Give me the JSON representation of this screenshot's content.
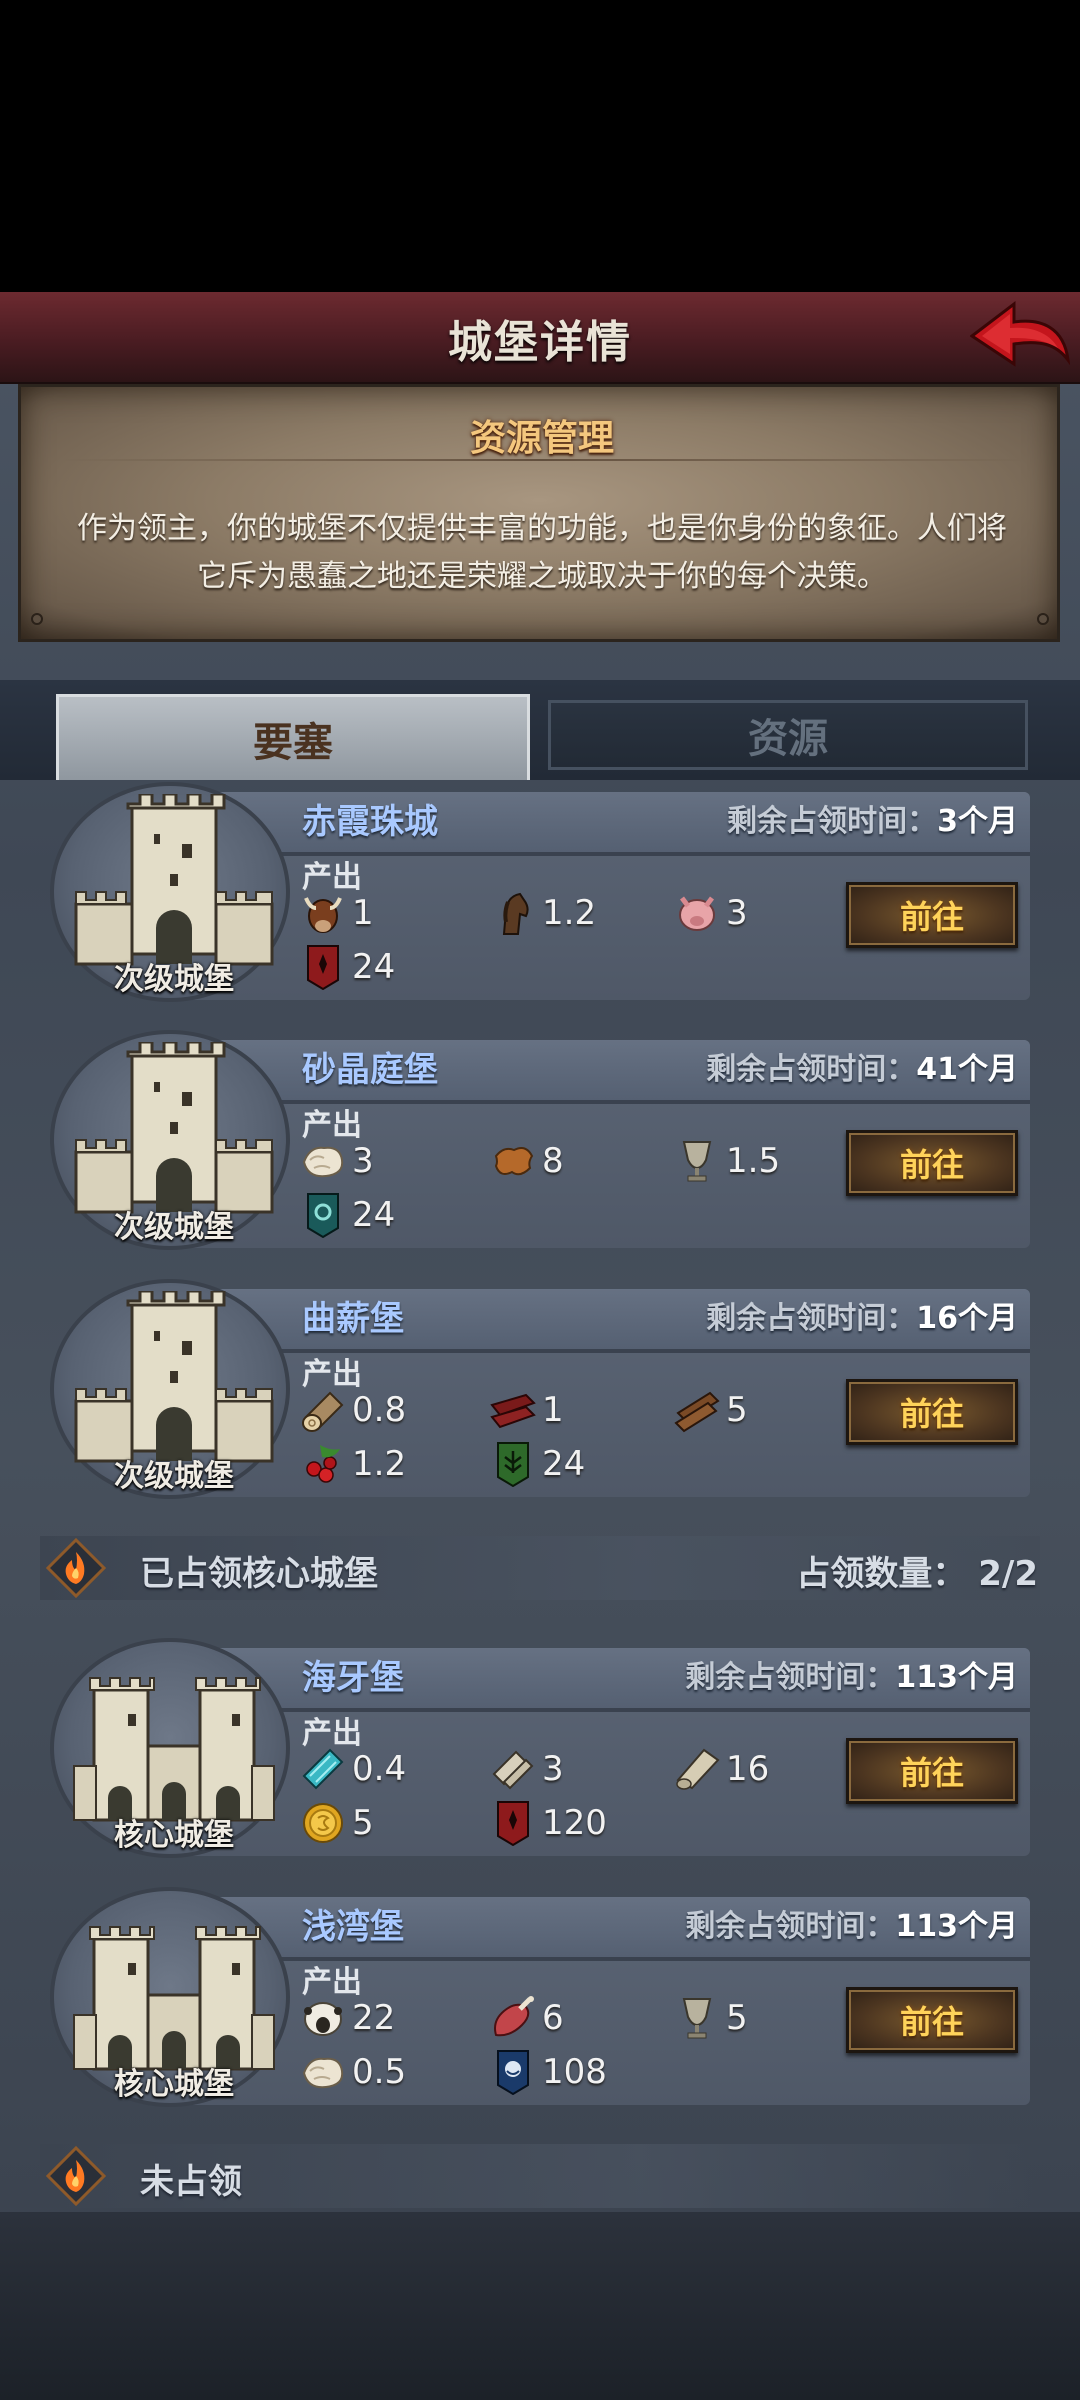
{
  "header": {
    "title": "城堡详情",
    "back_icon": "back-arrow-icon"
  },
  "info": {
    "title": "资源管理",
    "description_line1": "作为领主，你的城堡不仅提供丰富的功能，也是你身份的象征。人们将",
    "description_line2": "它斥为愚蠢之地还是荣耀之城取决于你的每个决策。"
  },
  "tabs": [
    {
      "label": "要塞",
      "active": true
    },
    {
      "label": "资源",
      "active": false
    }
  ],
  "cards": [
    {
      "name": "赤霞珠城",
      "type": "次级城堡",
      "remain_label": "剩余占领时间：",
      "remain_value": "3个月",
      "output_label": "产出",
      "go_label": "前往",
      "resources": [
        {
          "icon": "cow-icon",
          "value": "1"
        },
        {
          "icon": "horse-icon",
          "value": "1.2"
        },
        {
          "icon": "pig-icon",
          "value": "3"
        },
        {
          "icon": "red-banner-icon",
          "value": "24"
        }
      ]
    },
    {
      "name": "砂晶庭堡",
      "type": "次级城堡",
      "remain_label": "剩余占领时间：",
      "remain_value": "41个月",
      "output_label": "产出",
      "go_label": "前往",
      "resources": [
        {
          "icon": "wool-icon",
          "value": "3"
        },
        {
          "icon": "leather-icon",
          "value": "8"
        },
        {
          "icon": "goblet-icon",
          "value": "1.5"
        },
        {
          "icon": "teal-banner-icon",
          "value": "24"
        }
      ]
    },
    {
      "name": "曲薪堡",
      "type": "次级城堡",
      "remain_label": "剩余占领时间：",
      "remain_value": "16个月",
      "output_label": "产出",
      "go_label": "前往",
      "resources": [
        {
          "icon": "log-icon",
          "value": "0.8"
        },
        {
          "icon": "red-wood-icon",
          "value": "1"
        },
        {
          "icon": "plank-icon",
          "value": "5"
        },
        {
          "icon": "berries-icon",
          "value": "1.2"
        },
        {
          "icon": "green-banner-icon",
          "value": "24"
        }
      ]
    },
    {
      "name": "海牙堡",
      "type": "核心城堡",
      "remain_label": "剩余占领时间：",
      "remain_value": "113个月",
      "output_label": "产出",
      "go_label": "前往",
      "resources": [
        {
          "icon": "teal-cloth-icon",
          "value": "0.4"
        },
        {
          "icon": "scroll-icon",
          "value": "3"
        },
        {
          "icon": "parchment-icon",
          "value": "16"
        },
        {
          "icon": "gold-coin-icon",
          "value": "5"
        },
        {
          "icon": "red-banner-icon",
          "value": "120"
        }
      ]
    },
    {
      "name": "浅湾堡",
      "type": "核心城堡",
      "remain_label": "剩余占领时间：",
      "remain_value": "113个月",
      "output_label": "产出",
      "go_label": "前往",
      "resources": [
        {
          "icon": "sheep-icon",
          "value": "22"
        },
        {
          "icon": "meat-icon",
          "value": "6"
        },
        {
          "icon": "goblet-icon",
          "value": "5"
        },
        {
          "icon": "wool-icon",
          "value": "0.5"
        },
        {
          "icon": "blue-banner-icon",
          "value": "108"
        }
      ]
    }
  ],
  "sections": {
    "occupied": {
      "title": "已占领核心城堡",
      "count_label": "占领数量：",
      "count_value": "2/2",
      "icon": "flame-emblem-icon"
    },
    "unoccupied": {
      "title": "未占领",
      "icon": "flame-emblem-icon"
    }
  },
  "colors": {
    "accent_gold": "#ffd35a",
    "name_blue": "#a9c9ff",
    "title_red": "#6d2a30"
  }
}
